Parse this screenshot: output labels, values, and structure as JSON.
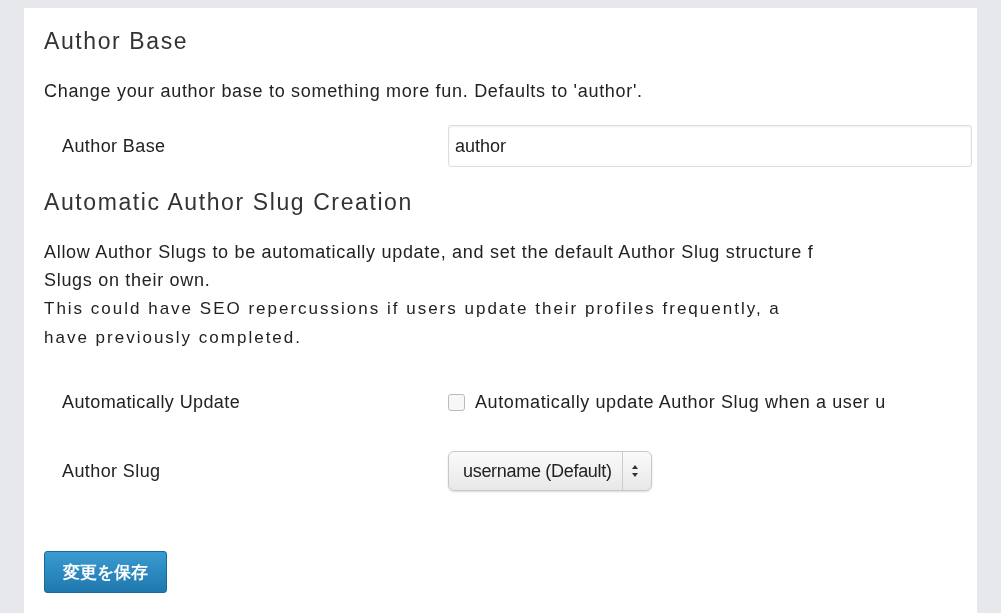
{
  "sections": [
    {
      "heading": "Author Base",
      "description_lines": [
        {
          "text": "Change your author base to something more fun. Defaults to 'author'.",
          "kind": "plain"
        }
      ],
      "fields": [
        {
          "kind": "text",
          "label": "Author Base",
          "value": "author"
        }
      ]
    },
    {
      "heading": "Automatic Author Slug Creation",
      "description_lines": [
        {
          "text": "Allow Author Slugs to be automatically update, and set the default Author Slug structure f",
          "kind": "plain"
        },
        {
          "text": "Slugs on their own.",
          "kind": "plain"
        },
        {
          "text": "This could have SEO repercussions if users update their profiles frequently, a",
          "kind": "spaced"
        },
        {
          "text": "have previously completed.",
          "kind": "spaced"
        }
      ],
      "fields": [
        {
          "kind": "checkbox",
          "label": "Automatically Update",
          "checked": false,
          "option": "Automatically update Author Slug when a user u"
        },
        {
          "kind": "select",
          "label": "Author Slug",
          "value": "username (Default)"
        }
      ]
    }
  ],
  "save_button": "変更を保存"
}
